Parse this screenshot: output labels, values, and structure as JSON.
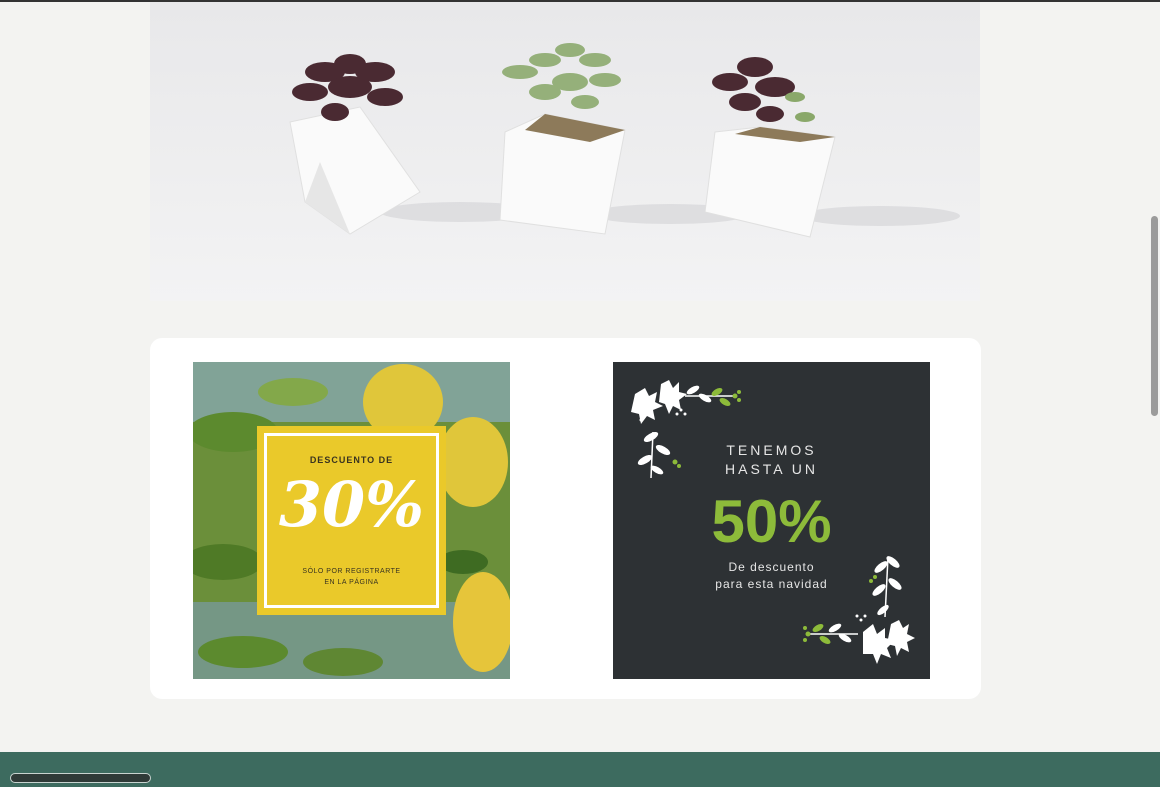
{
  "hero": {
    "image": "three-succulent-pots-photo",
    "background_color": "#ececed"
  },
  "promos": {
    "lemon": {
      "heading": "DESCUENTO DE",
      "value": "30%",
      "sub_line1": "SÓLO POR REGISTRARTE",
      "sub_line2": "EN LA PÁGINA",
      "box_color": "#eac92a"
    },
    "christmas": {
      "line1": "TENEMOS",
      "line2": "HASTA UN",
      "value": "50%",
      "line3": "De descuento",
      "line4": "para esta navidad",
      "background_color": "#2d3134",
      "accent_color": "#8dbb3a"
    }
  },
  "footer": {
    "background_color": "#3d6b5f"
  }
}
